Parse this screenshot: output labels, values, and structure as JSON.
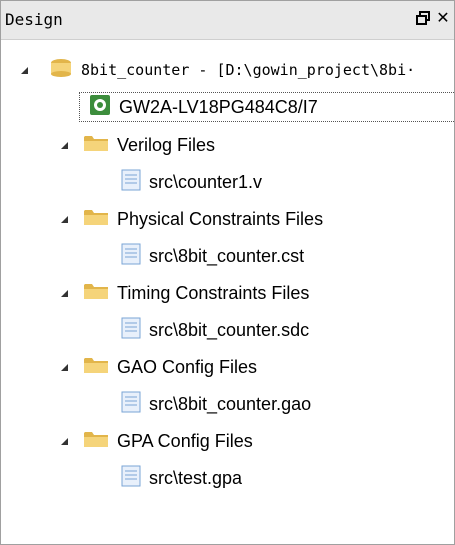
{
  "panel": {
    "title": "Design",
    "restore_icon": "restore-window-icon",
    "close_icon": "close-icon"
  },
  "tree": {
    "project": {
      "label": "8bit_counter - [D:\\gowin_project\\8bi·",
      "icon": "project-folder-icon"
    },
    "device": {
      "label": "GW2A-LV18PG484C8/I7",
      "icon": "fpga-device-icon"
    },
    "groups": [
      {
        "label": "Verilog Files",
        "file": "src\\counter1.v"
      },
      {
        "label": "Physical Constraints Files",
        "file": "src\\8bit_counter.cst"
      },
      {
        "label": "Timing Constraints Files",
        "file": "src\\8bit_counter.sdc"
      },
      {
        "label": "GAO Config Files",
        "file": "src\\8bit_counter.gao"
      },
      {
        "label": "GPA Config Files",
        "file": "src\\test.gpa"
      }
    ]
  },
  "colors": {
    "folder": "#f5d47a",
    "folder_dark": "#e2b54a",
    "device_green": "#3c8d3c"
  }
}
